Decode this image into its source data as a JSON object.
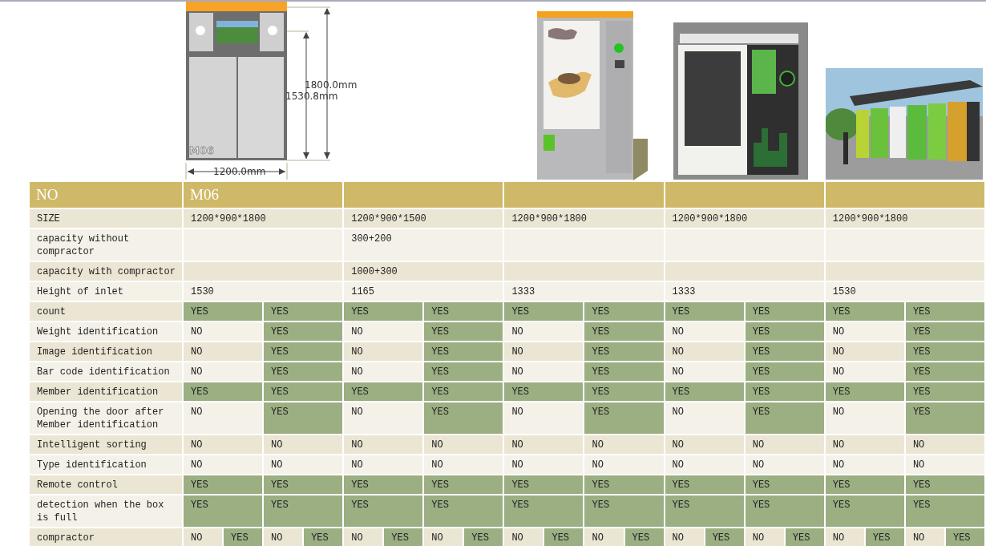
{
  "drawing": {
    "model_mark": "M06",
    "height_label": "1800.0mm",
    "inlet_label": "1530.8mm",
    "width_label": "1200.0mm"
  },
  "header": {
    "label": "NO",
    "models": [
      "M06"
    ]
  },
  "rows": [
    {
      "kind": "spec",
      "label": "SIZE",
      "values": [
        {
          "text": "1200*900*1800"
        },
        {
          "text": "1200*900*1500"
        },
        {
          "text": "1200*900*1800"
        },
        {
          "text": "1200*900*1800"
        },
        {
          "text": "1200*900*1800"
        }
      ]
    },
    {
      "kind": "spec",
      "label": "capacity without compractor",
      "values": [
        {
          "empty": true
        },
        {
          "text": "300+200"
        },
        {
          "empty": true
        },
        {
          "empty": true
        },
        {
          "empty": true
        }
      ]
    },
    {
      "kind": "spec",
      "label": "capacity with compractor",
      "values": [
        {
          "empty": true
        },
        {
          "text": "1000+300"
        },
        {
          "empty": true
        },
        {
          "empty": true
        },
        {
          "empty": true
        }
      ]
    },
    {
      "kind": "spec",
      "label": "Height of inlet",
      "values": [
        {
          "text": "1530"
        },
        {
          "text": "1165"
        },
        {
          "text": "1333"
        },
        {
          "text": "1333"
        },
        {
          "text": "1530"
        }
      ]
    },
    {
      "kind": "feature",
      "label": "count",
      "cells": [
        {
          "text": "YES",
          "on": true
        },
        {
          "text": "YES",
          "on": true
        },
        {
          "text": "YES",
          "on": true
        },
        {
          "text": "YES",
          "on": true
        },
        {
          "text": "YES",
          "on": true
        },
        {
          "text": "YES",
          "on": true
        },
        {
          "text": "YES",
          "on": true
        },
        {
          "text": "YES",
          "on": true
        },
        {
          "text": "YES",
          "on": true
        },
        {
          "text": "YES",
          "on": true
        }
      ]
    },
    {
      "kind": "feature",
      "label": "Weight identification",
      "cells": [
        {
          "text": "NO",
          "on": false
        },
        {
          "text": "YES",
          "on": true
        },
        {
          "text": "NO",
          "on": false
        },
        {
          "text": "YES",
          "on": true
        },
        {
          "text": "NO",
          "on": false
        },
        {
          "text": "YES",
          "on": true
        },
        {
          "text": "NO",
          "on": false
        },
        {
          "text": "YES",
          "on": true
        },
        {
          "text": "NO",
          "on": false
        },
        {
          "text": "YES",
          "on": true
        }
      ]
    },
    {
      "kind": "feature",
      "label": "Image identification",
      "cells": [
        {
          "text": "NO",
          "on": false
        },
        {
          "text": "YES",
          "on": true
        },
        {
          "text": "NO",
          "on": false
        },
        {
          "text": "YES",
          "on": true
        },
        {
          "text": "NO",
          "on": false
        },
        {
          "text": "YES",
          "on": true
        },
        {
          "text": "NO",
          "on": false
        },
        {
          "text": "YES",
          "on": true
        },
        {
          "text": "NO",
          "on": false
        },
        {
          "text": "YES",
          "on": true
        }
      ]
    },
    {
      "kind": "feature",
      "label": "Bar code identification",
      "cells": [
        {
          "text": "NO",
          "on": false
        },
        {
          "text": "YES",
          "on": true
        },
        {
          "text": "NO",
          "on": false
        },
        {
          "text": "YES",
          "on": true
        },
        {
          "text": "NO",
          "on": false
        },
        {
          "text": "YES",
          "on": true
        },
        {
          "text": "NO",
          "on": false
        },
        {
          "text": "YES",
          "on": true
        },
        {
          "text": "NO",
          "on": false
        },
        {
          "text": "YES",
          "on": true
        }
      ]
    },
    {
      "kind": "feature",
      "label": "Member identification",
      "cells": [
        {
          "text": "YES",
          "on": true
        },
        {
          "text": "YES",
          "on": true
        },
        {
          "text": "YES",
          "on": true
        },
        {
          "text": "YES",
          "on": true
        },
        {
          "text": "YES",
          "on": true
        },
        {
          "text": "YES",
          "on": true
        },
        {
          "text": "YES",
          "on": true
        },
        {
          "text": "YES",
          "on": true
        },
        {
          "text": "YES",
          "on": true
        },
        {
          "text": "YES",
          "on": true
        }
      ]
    },
    {
      "kind": "feature",
      "label": "Opening the door after Member identification",
      "cells": [
        {
          "text": "NO",
          "on": false
        },
        {
          "text": "YES",
          "on": true
        },
        {
          "text": "NO",
          "on": false
        },
        {
          "text": "YES",
          "on": true
        },
        {
          "text": "NO",
          "on": false
        },
        {
          "text": "YES",
          "on": true
        },
        {
          "text": "NO",
          "on": false
        },
        {
          "text": "YES",
          "on": true
        },
        {
          "text": "NO",
          "on": false
        },
        {
          "text": "YES",
          "on": true
        }
      ]
    },
    {
      "kind": "feature",
      "label": "Intelligent sorting",
      "cells": [
        {
          "text": "NO",
          "on": false
        },
        {
          "text": "NO",
          "on": false
        },
        {
          "text": "NO",
          "on": false
        },
        {
          "text": "NO",
          "on": false
        },
        {
          "text": "NO",
          "on": false
        },
        {
          "text": "NO",
          "on": false
        },
        {
          "text": "NO",
          "on": false
        },
        {
          "text": "NO",
          "on": false
        },
        {
          "text": "NO",
          "on": false
        },
        {
          "text": "NO",
          "on": false
        }
      ]
    },
    {
      "kind": "feature",
      "label": "Type identification",
      "cells": [
        {
          "text": "NO",
          "on": false
        },
        {
          "text": "NO",
          "on": false
        },
        {
          "text": "NO",
          "on": false
        },
        {
          "text": "NO",
          "on": false
        },
        {
          "text": "NO",
          "on": false
        },
        {
          "text": "NO",
          "on": false
        },
        {
          "text": "NO",
          "on": false
        },
        {
          "text": "NO",
          "on": false
        },
        {
          "text": "NO",
          "on": false
        },
        {
          "text": "NO",
          "on": false
        }
      ]
    },
    {
      "kind": "feature",
      "label": "Remote control",
      "cells": [
        {
          "text": "YES",
          "on": true
        },
        {
          "text": "YES",
          "on": true
        },
        {
          "text": "YES",
          "on": true
        },
        {
          "text": "YES",
          "on": true
        },
        {
          "text": "YES",
          "on": true
        },
        {
          "text": "YES",
          "on": true
        },
        {
          "text": "YES",
          "on": true
        },
        {
          "text": "YES",
          "on": true
        },
        {
          "text": "YES",
          "on": true
        },
        {
          "text": "YES",
          "on": true
        }
      ]
    },
    {
      "kind": "feature",
      "label": "detection when the box is full",
      "cells": [
        {
          "text": "YES",
          "on": true
        },
        {
          "text": "YES",
          "on": true
        },
        {
          "text": "YES",
          "on": true
        },
        {
          "text": "YES",
          "on": true
        },
        {
          "text": "YES",
          "on": true
        },
        {
          "text": "YES",
          "on": true
        },
        {
          "text": "YES",
          "on": true
        },
        {
          "text": "YES",
          "on": true
        },
        {
          "text": "YES",
          "on": true
        },
        {
          "text": "YES",
          "on": true
        }
      ]
    },
    {
      "kind": "option",
      "label": "compractor",
      "cells": [
        {
          "text": "NO",
          "on": false
        },
        {
          "text": "YES",
          "on": true
        },
        {
          "text": "NO",
          "on": false
        },
        {
          "text": "YES",
          "on": true
        },
        {
          "text": "NO",
          "on": false
        },
        {
          "text": "YES",
          "on": true
        },
        {
          "text": "NO",
          "on": false
        },
        {
          "text": "YES",
          "on": true
        },
        {
          "text": "NO",
          "on": false
        },
        {
          "text": "YES",
          "on": true
        },
        {
          "text": "NO",
          "on": false
        },
        {
          "text": "YES",
          "on": true
        },
        {
          "text": "NO",
          "on": false
        },
        {
          "text": "YES",
          "on": true
        },
        {
          "text": "NO",
          "on": false
        },
        {
          "text": "YES",
          "on": true
        },
        {
          "text": "NO",
          "on": false
        },
        {
          "text": "YES",
          "on": true
        },
        {
          "text": "NO",
          "on": false
        },
        {
          "text": "YES",
          "on": true
        }
      ]
    }
  ]
}
